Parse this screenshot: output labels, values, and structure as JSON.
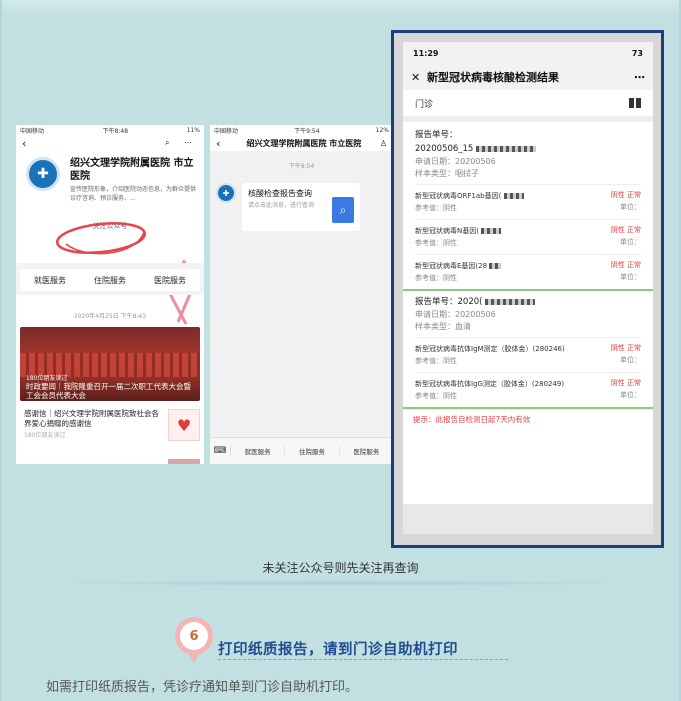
{
  "phone1": {
    "status": {
      "carrier": "中国移动",
      "time": "下午8:48",
      "battery": "11%"
    },
    "account_name": "绍兴文理学院附属医院 市立医院",
    "account_desc": "宣传医院形象，介绍医院动态信息，为群众提供诊疗咨询、预诊服务、...",
    "follow_label": "关注公众号",
    "menu": [
      "就医服务",
      "住院服务",
      "医院服务"
    ],
    "date": "2020年4月25日 下午8:43",
    "banner_count": "180位朋友读过",
    "banner_headline": "时政要闻｜我院隆重召开一届二次职工代表大会暨工会会员代表大会",
    "article_title": "感谢信｜绍兴文理学院附属医院致社会各界爱心捐赠的感谢信",
    "article_meta": "180位朋友读过"
  },
  "phone2": {
    "status": {
      "carrier": "中国移动",
      "time": "下午9:54",
      "battery": "12%"
    },
    "nav_title": "绍兴文理学院附属医院 市立医院",
    "msg_time": "下午9:54",
    "card_title": "核酸检查报告查询",
    "card_desc": "请点击此消息，进行查询",
    "bottom_menu": [
      "就医服务",
      "住院服务",
      "医院服务"
    ]
  },
  "phone3": {
    "status_time": "11:29",
    "battery": "73",
    "title": "新型冠状病毒核酸检测结果",
    "dept": "门诊",
    "report1": {
      "label": "报告单号：",
      "number": "20200506_15",
      "apply_date": "申请日期：20200506",
      "sample": "样本类型：咽拭子",
      "items": [
        {
          "name": "新型冠状病毒ORF1ab基因(",
          "ref": "参考值：阴性",
          "result": "阴性  正常",
          "unit": "单位："
        },
        {
          "name": "新型冠状病毒N基因(",
          "ref": "参考值：阴性",
          "result": "阴性  正常",
          "unit": "单位："
        },
        {
          "name": "新型冠状病毒E基因(28",
          "ref": "参考值：阴性",
          "result": "阴性  正常",
          "unit": "单位："
        }
      ]
    },
    "report2": {
      "number": "报告单号：2020(",
      "apply_date": "申请日期：20200506",
      "sample": "样本类型：血清",
      "items": [
        {
          "name": "新型冠状病毒抗体IgM测定（胶体金）(280246)",
          "ref": "参考值：阴性",
          "result": "阴性  正常",
          "unit": "单位："
        },
        {
          "name": "新型冠状病毒抗体IgG测定（胶体金）(280249)",
          "ref": "参考值：阴性",
          "result": "阴性  正常",
          "unit": "单位："
        }
      ]
    },
    "tip": "提示：此报告自检测日起7天内有效"
  },
  "caption": "未关注公众号则先关注再查询",
  "step": {
    "number": "6",
    "title": "打印纸质报告，请到门诊自助机打印"
  },
  "bottom_text": "如需打印纸质报告，凭诊疗通知单到门诊自助机打印。",
  "colors": {
    "background": "#c2e0e2",
    "frame": "#1d3f7a",
    "result_red": "#e04040",
    "step_title": "#1f4d8f"
  }
}
